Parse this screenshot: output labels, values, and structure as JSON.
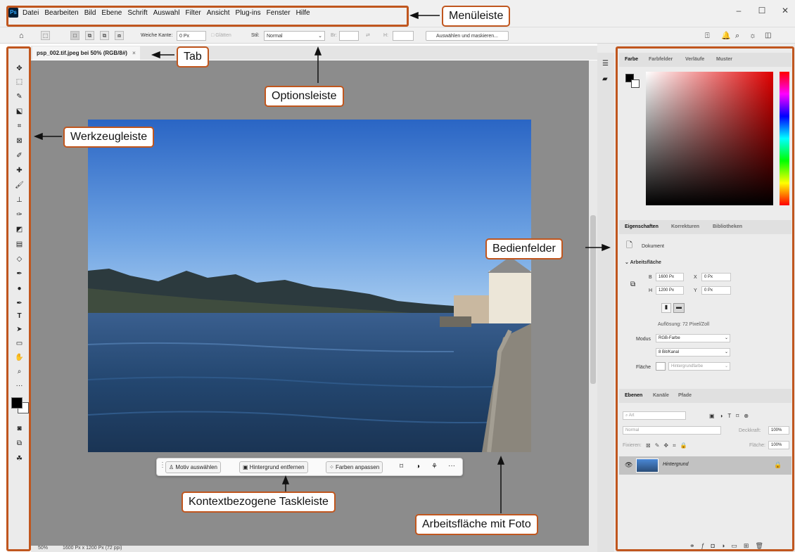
{
  "app": {
    "logo": "Ps"
  },
  "menu": {
    "items": [
      "Datei",
      "Bearbeiten",
      "Bild",
      "Ebene",
      "Schrift",
      "Auswahl",
      "Filter",
      "Ansicht",
      "Plug-ins",
      "Fenster",
      "Hilfe"
    ]
  },
  "window_controls": {
    "minimize": "–",
    "maximize": "☐",
    "close": "✕"
  },
  "options": {
    "soft_edge_label": "Weiche Kante:",
    "soft_edge_value": "0 Px",
    "smooth_label": "Glätten",
    "style_label": "Stil:",
    "style_value": "Normal",
    "width_label": "Br:",
    "height_label": "H:",
    "select_mask_button": "Auswählen und maskieren..."
  },
  "document": {
    "tab_title": "psp_002.tif.jpeg bei 50% (RGB/8#)",
    "tab_close": "×"
  },
  "statusbar": {
    "zoom": "50%",
    "info": "1600 Px x 1200 Px (72 ppi)"
  },
  "color_panel": {
    "tabs": [
      "Farbe",
      "Farbfelder",
      "Verläufe",
      "Muster"
    ]
  },
  "properties_panel": {
    "tabs": [
      "Eigenschaften",
      "Korrekturen",
      "Bibliotheken"
    ],
    "doc_label": "Dokument",
    "section": "Arbeitsfläche",
    "w_label": "B",
    "w_value": "1600 Px",
    "x_label": "X",
    "x_value": "0 Px",
    "h_label": "H",
    "h_value": "1200 Px",
    "y_label": "Y",
    "y_value": "0 Px",
    "resolution": "Auflösung: 72 Pixel/Zoll",
    "mode_label": "Modus",
    "mode_value": "RGB-Farbe",
    "depth_value": "8 Bit/Kanal",
    "fill_label": "Fläche",
    "fill_value": "Hintergrundfarbe"
  },
  "layers_panel": {
    "tabs": [
      "Ebenen",
      "Kanäle",
      "Pfade"
    ],
    "filter_placeholder": "Art",
    "blend_mode": "Normal",
    "opacity_label": "Deckkraft:",
    "opacity_value": "100%",
    "lock_label": "Fixieren:",
    "fill_label": "Fläche:",
    "fill_value": "100%",
    "layer_name": "Hintergrund"
  },
  "context_bar": {
    "buttons": [
      "Motiv auswählen",
      "Hintergrund entfernen",
      "Farben anpassen"
    ],
    "more": "···"
  },
  "callouts": {
    "menubar": "Menüleiste",
    "tab": "Tab",
    "optionsbar": "Optionsleiste",
    "toolbar": "Werkzeugleiste",
    "panels": "Bedienfelder",
    "context_taskbar": "Kontextbezogene Taskleiste",
    "canvas": "Arbeitsfläche mit Foto"
  },
  "colors": {
    "accent_frame": "#c0561e",
    "canvas_bg": "#8c8c8c",
    "ui_bg": "#f0f0f0"
  }
}
